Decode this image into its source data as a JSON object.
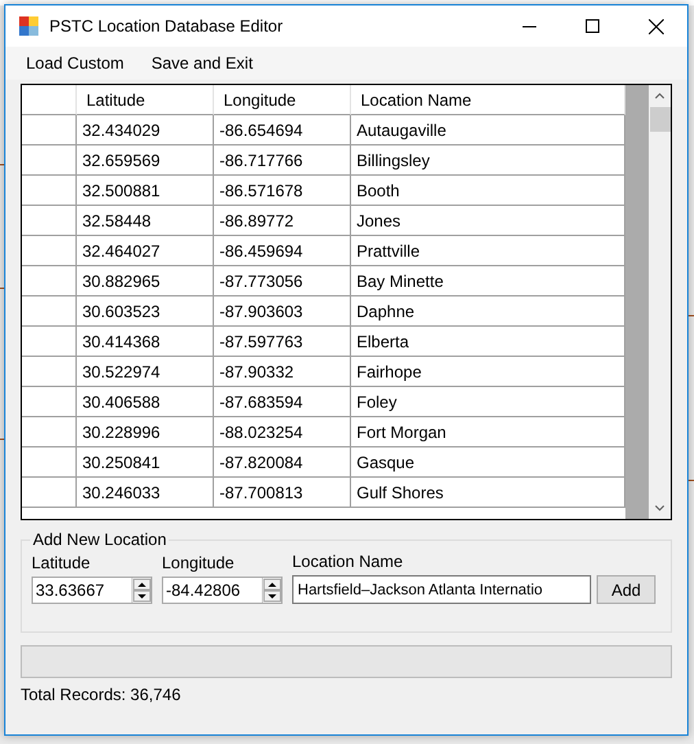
{
  "window": {
    "title": "PSTC Location Database Editor"
  },
  "menu": [
    "Load Custom",
    "Save and Exit"
  ],
  "table": {
    "columns": [
      "Latitude",
      "Longitude",
      "Location Name"
    ],
    "rows": [
      [
        "32.434029",
        "-86.654694",
        "Autaugaville"
      ],
      [
        "32.659569",
        "-86.717766",
        "Billingsley"
      ],
      [
        "32.500881",
        "-86.571678",
        "Booth"
      ],
      [
        "32.58448",
        "-86.89772",
        "Jones"
      ],
      [
        "32.464027",
        "-86.459694",
        "Prattville"
      ],
      [
        "30.882965",
        "-87.773056",
        "Bay Minette"
      ],
      [
        "30.603523",
        "-87.903603",
        "Daphne"
      ],
      [
        "30.414368",
        "-87.597763",
        "Elberta"
      ],
      [
        "30.522974",
        "-87.90332",
        "Fairhope"
      ],
      [
        "30.406588",
        "-87.683594",
        "Foley"
      ],
      [
        "30.228996",
        "-88.023254",
        "Fort Morgan"
      ],
      [
        "30.250841",
        "-87.820084",
        "Gasque"
      ],
      [
        "30.246033",
        "-87.700813",
        "Gulf Shores"
      ]
    ]
  },
  "add_new_location": {
    "title": "Add New Location",
    "fields": [
      {
        "label": "Latitude",
        "value": "33.63667",
        "kind": "spinner"
      },
      {
        "label": "Longitude",
        "value": "-84.42806",
        "kind": "spinner"
      },
      {
        "label": "Location Name",
        "value": "Hartsfield–Jackson Atlanta Internatio",
        "kind": "text"
      }
    ],
    "button": "Add"
  },
  "progress": {
    "level": 0
  },
  "status": "Total Records: 36,746"
}
